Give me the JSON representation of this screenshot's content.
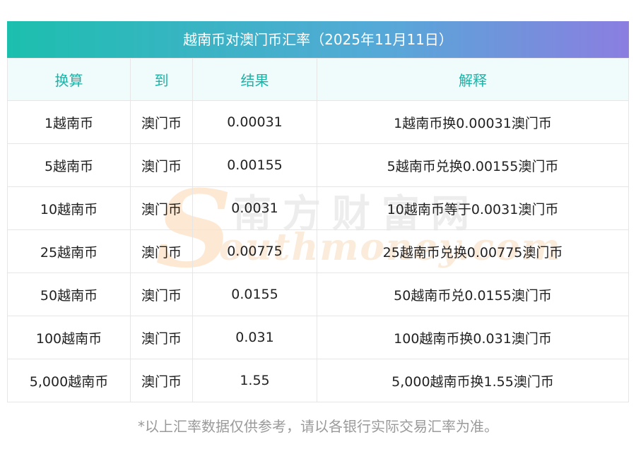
{
  "title": "越南币对澳门币汇率（2025年11月11日）",
  "watermark": {
    "logo_letter": "S",
    "cn": "南方财富网",
    "en": "outhmoney.com"
  },
  "table": {
    "headers": [
      "换算",
      "到",
      "结果",
      "解释"
    ],
    "rows": [
      [
        "1越南币",
        "澳门币",
        "0.00031",
        "1越南币换0.00031澳门币"
      ],
      [
        "5越南币",
        "澳门币",
        "0.00155",
        "5越南币兑换0.00155澳门币"
      ],
      [
        "10越南币",
        "澳门币",
        "0.0031",
        "10越南币等于0.0031澳门币"
      ],
      [
        "25越南币",
        "澳门币",
        "0.00775",
        "25越南币兑换0.00775澳门币"
      ],
      [
        "50越南币",
        "澳门币",
        "0.0155",
        "50越南币兑0.0155澳门币"
      ],
      [
        "100越南币",
        "澳门币",
        "0.031",
        "100越南币换0.031澳门币"
      ],
      [
        "5,000越南币",
        "澳门币",
        "1.55",
        "5,000越南币换1.55澳门币"
      ]
    ]
  },
  "footnote": "*以上汇率数据仅供参考，请以各银行实际交易汇率为准。",
  "colors": {
    "header_text": "#19b3a8",
    "header_bg": "#f0fcfc",
    "title_gradient_start": "#1cbfae",
    "title_gradient_end": "#8b7ee0"
  }
}
